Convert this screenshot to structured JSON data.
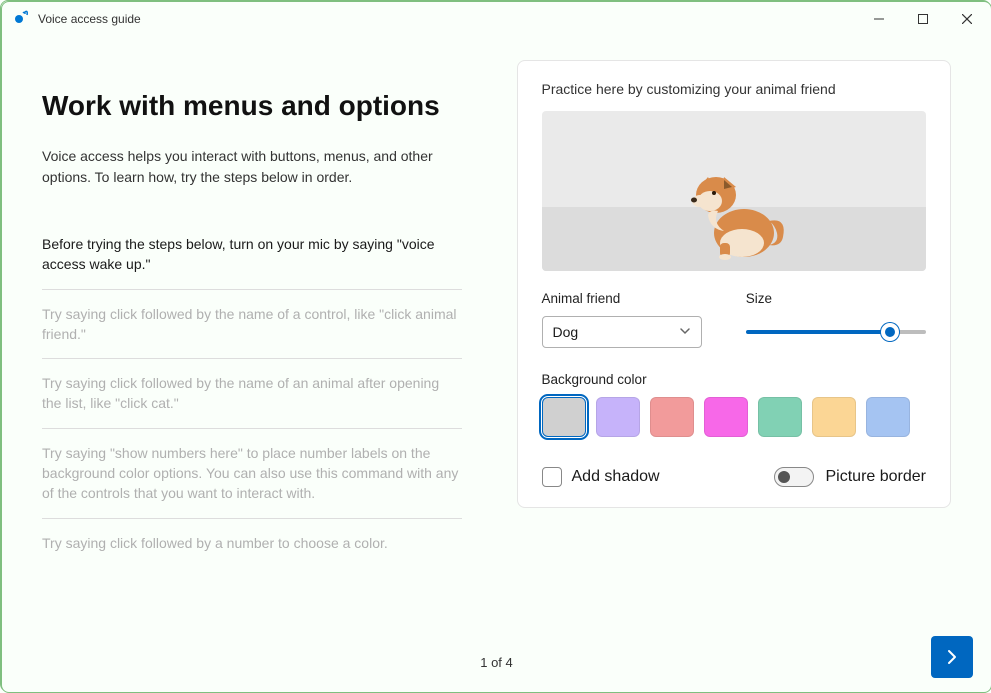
{
  "window": {
    "title": "Voice access guide"
  },
  "page": {
    "title": "Work with menus and options",
    "description": "Voice access helps you interact with buttons, menus, and other options. To learn how, try the steps below in order."
  },
  "steps": [
    {
      "text": "Before trying the steps below, turn on your mic by saying \"voice access wake up.\"",
      "active": true
    },
    {
      "text": "Try saying click followed by the name of a control, like \"click animal friend.\"",
      "active": false
    },
    {
      "text": "Try saying click followed by the name of an animal after opening the list, like \"click cat.\"",
      "active": false
    },
    {
      "text": "Try saying \"show numbers here\" to place number labels on the background color options. You can also use this command with any of the controls that you want to interact with.",
      "active": false
    },
    {
      "text": "Try saying click followed by a number to choose a color.",
      "active": false
    }
  ],
  "practice": {
    "heading": "Practice here by customizing your animal friend",
    "animal_label": "Animal friend",
    "animal_value": "Dog",
    "size_label": "Size",
    "size_value": 80,
    "bgcolor_label": "Background color",
    "colors": [
      {
        "hex": "#d0d0d0",
        "name": "gray",
        "selected": true
      },
      {
        "hex": "#c6b3fa",
        "name": "lavender",
        "selected": false
      },
      {
        "hex": "#f29b9b",
        "name": "salmon",
        "selected": false
      },
      {
        "hex": "#f768e8",
        "name": "magenta",
        "selected": false
      },
      {
        "hex": "#81d1b4",
        "name": "mint",
        "selected": false
      },
      {
        "hex": "#fbd695",
        "name": "peach",
        "selected": false
      },
      {
        "hex": "#a5c4f2",
        "name": "light-blue",
        "selected": false
      }
    ],
    "add_shadow_label": "Add shadow",
    "add_shadow_checked": false,
    "picture_border_label": "Picture border",
    "picture_border_on": false
  },
  "footer": {
    "pager": "1 of 4"
  }
}
